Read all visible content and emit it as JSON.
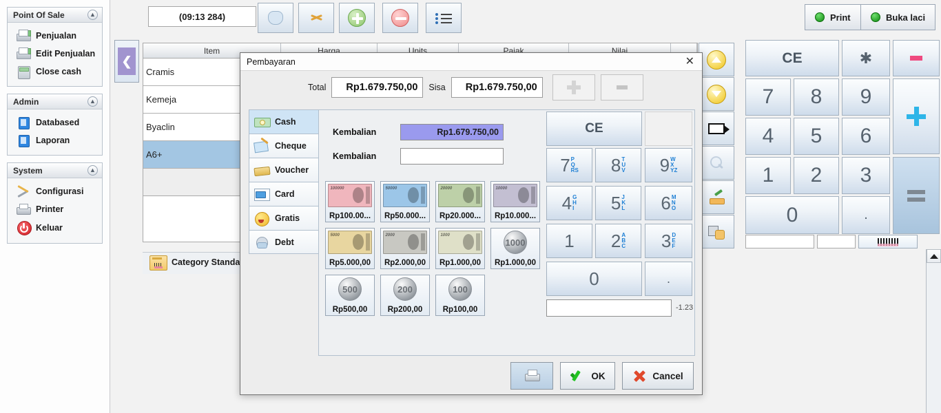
{
  "sidebar": {
    "sections": [
      {
        "title": "Point Of Sale",
        "collapse_icon": "chevron-up-icon",
        "items": [
          {
            "label": "Penjualan",
            "icon": "sale-printer-icon"
          },
          {
            "label": "Edit Penjualan",
            "icon": "edit-sale-icon"
          },
          {
            "label": "Close cash",
            "icon": "calculator-icon"
          }
        ]
      },
      {
        "title": "Admin",
        "collapse_icon": "chevron-up-icon",
        "items": [
          {
            "label": "Databased",
            "icon": "database-icon"
          },
          {
            "label": "Laporan",
            "icon": "report-icon"
          }
        ]
      },
      {
        "title": "System",
        "collapse_icon": "chevron-up-icon",
        "items": [
          {
            "label": "Configurasi",
            "icon": "wrench-icon"
          },
          {
            "label": "Printer",
            "icon": "printer-icon"
          },
          {
            "label": "Keluar",
            "icon": "power-icon"
          }
        ]
      }
    ]
  },
  "collapse_handle": {
    "icon": "chevron-left-icon"
  },
  "toolbar": {
    "timer_value": "(09:13 284)",
    "buttons": [
      {
        "name": "customer-button",
        "icon": "customer-mask-icon"
      },
      {
        "name": "discount-button",
        "icon": "scissors-icon"
      },
      {
        "name": "add-line-button",
        "icon": "plus-circle-green-icon"
      },
      {
        "name": "remove-line-button",
        "icon": "minus-circle-red-icon"
      },
      {
        "name": "list-button",
        "icon": "bullet-list-icon"
      }
    ],
    "print_label": "Print",
    "drawer_label": "Buka laci"
  },
  "table": {
    "columns": [
      "Item",
      "Harga",
      "Units",
      "Pajak",
      "Nilai",
      ""
    ],
    "rows": [
      {
        "item": "Cramis",
        "harga": "",
        "units": "",
        "pajak": "",
        "nilai": "",
        "selected": false
      },
      {
        "item": "Kemeja",
        "harga": "",
        "units": "",
        "pajak": "",
        "nilai": "",
        "selected": false
      },
      {
        "item": "Byaclin",
        "harga": "",
        "units": "",
        "pajak": "",
        "nilai": "",
        "selected": false
      },
      {
        "item": "A6+",
        "harga": "",
        "units": "",
        "pajak": "",
        "nilai": "",
        "selected": true
      }
    ]
  },
  "icon_column": [
    {
      "name": "move-up-button",
      "icon": "yellow-up-arrow-icon"
    },
    {
      "name": "move-down-button",
      "icon": "yellow-down-arrow-icon"
    },
    {
      "name": "tag-button",
      "icon": "price-tag-icon"
    },
    {
      "name": "search-button",
      "icon": "magnifier-icon"
    },
    {
      "name": "edit-button",
      "icon": "pencil-icon"
    },
    {
      "name": "keyboard-button",
      "icon": "grid-hand-icon"
    }
  ],
  "keypad": {
    "ce_label": "CE",
    "star_label": "✱",
    "minus_icon": "minus-pink-icon",
    "plus_icon": "plus-blue-icon",
    "equals_icon": "equals-gray-icon",
    "keys": [
      "7",
      "8",
      "9",
      "4",
      "5",
      "6",
      "1",
      "2",
      "3",
      "0",
      "."
    ]
  },
  "bottom_bar": {
    "barcode_icon": "barcode-icon",
    "scroll_up_icon": "caret-up-icon"
  },
  "category_bar": {
    "label": "Category Standard",
    "icon": "category-folder-icon"
  },
  "dialog": {
    "title": "Pembayaran",
    "close_icon": "close-icon",
    "total_label": "Total",
    "total_value": "Rp1.679.750,00",
    "sisa_label": "Sisa",
    "sisa_value": "Rp1.679.750,00",
    "plus_button_icon": "plus-icon",
    "minus_button_icon": "minus-icon",
    "tabs": [
      {
        "label": "Cash",
        "icon": "cash-icon",
        "selected": true
      },
      {
        "label": "Cheque",
        "icon": "cheque-icon",
        "selected": false
      },
      {
        "label": "Voucher",
        "icon": "voucher-icon",
        "selected": false
      },
      {
        "label": "Card",
        "icon": "card-icon",
        "selected": false
      },
      {
        "label": "Gratis",
        "icon": "gratis-icon",
        "selected": false
      },
      {
        "label": "Debt",
        "icon": "debt-icon",
        "selected": false
      }
    ],
    "kembalian_label_1": "Kembalian",
    "kembalian_value_1": "Rp1.679.750,00",
    "kembalian_label_2": "Kembalian",
    "kembalian_value_2": "",
    "denominations": [
      {
        "caption": "Rp100.00...",
        "kind": "note",
        "color": "#f0b6bd"
      },
      {
        "caption": "Rp50.000...",
        "kind": "note",
        "color": "#9cc6e8"
      },
      {
        "caption": "Rp20.000...",
        "kind": "note",
        "color": "#bdd0a8"
      },
      {
        "caption": "Rp10.000...",
        "kind": "note",
        "color": "#c3bfd2"
      },
      {
        "caption": "Rp5.000,00",
        "kind": "note",
        "color": "#e8d6a0"
      },
      {
        "caption": "Rp2.000,00",
        "kind": "note",
        "color": "#c8c8c2"
      },
      {
        "caption": "Rp1.000,00",
        "kind": "note",
        "color": "#dfe0c8"
      },
      {
        "caption": "Rp1.000,00",
        "kind": "coin",
        "face": "1000"
      },
      {
        "caption": "Rp500,00",
        "kind": "coin",
        "face": "500"
      },
      {
        "caption": "Rp200,00",
        "kind": "coin",
        "face": "200"
      },
      {
        "caption": "Rp100,00",
        "kind": "coin",
        "face": "100"
      }
    ],
    "keypad": {
      "ce_label": "CE",
      "blank_label": "",
      "keys": [
        {
          "num": "7",
          "letters": "PQRS"
        },
        {
          "num": "8",
          "letters": "TUV"
        },
        {
          "num": "9",
          "letters": "WXYZ"
        },
        {
          "num": "4",
          "letters": "GHI"
        },
        {
          "num": "5",
          "letters": "JKL"
        },
        {
          "num": "6",
          "letters": "MNO"
        },
        {
          "num": "1",
          "letters": ""
        },
        {
          "num": "2",
          "letters": "ABC"
        },
        {
          "num": "3",
          "letters": "DEF"
        },
        {
          "num": "0",
          "letters": ""
        },
        {
          "num": ".",
          "letters": ""
        }
      ]
    },
    "amount_input_value": "",
    "amount_note": "-1.23",
    "footer": {
      "print_icon": "printer-icon",
      "ok_label": "OK",
      "ok_icon": "check-icon",
      "cancel_label": "Cancel",
      "cancel_icon": "x-icon"
    }
  },
  "colors": {
    "accent_blue": "#2eb5e8",
    "selection_blue": "#a3c6e3",
    "highlight_purple": "#9a9aee",
    "handle_purple": "#a194cf"
  }
}
